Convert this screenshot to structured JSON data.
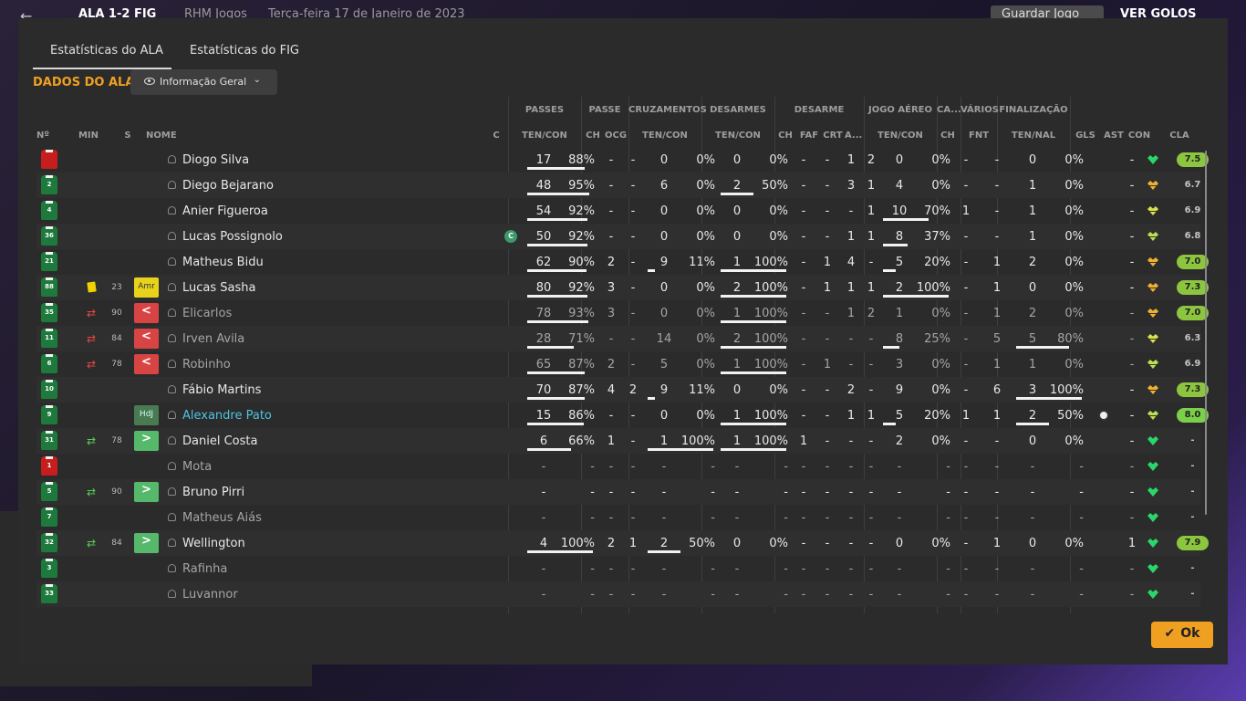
{
  "topbar": {
    "back": "←",
    "score": "ALA 1-2 FIG",
    "competition": "RHM Jogos",
    "date": "Terça-feira 17 de Janeiro de 2023",
    "save": "Guardar Jogo",
    "goals": "VER GOLOS"
  },
  "tabs": [
    {
      "label": "Estatísticas do ALA",
      "active": true
    },
    {
      "label": "Estatísticas do FIG",
      "active": false
    }
  ],
  "section_title": "DADOS DO ALA",
  "view_dropdown": {
    "label": "Informação Geral",
    "icon": "eye-icon"
  },
  "group_headers": [
    "PASSES",
    "PASSE",
    "CRUZAMENTOS",
    "DESARMES",
    "DESARME",
    "JOGO AÉREO",
    "CA...",
    "VÁRIOS",
    "FINALIZAÇÃO"
  ],
  "col_headers": {
    "no": "Nº",
    "min": "MIN",
    "s": "S",
    "name": "NOME",
    "c": "C",
    "passes": "TEN/CON",
    "passe_ch": "CH",
    "passe_ocg": "OCG",
    "cruz": "TEN/CON",
    "desarmes": "TEN/CON",
    "des_ch": "CH",
    "des_faf": "FAF",
    "des_crt": "CRT",
    "des_a": "A...",
    "aereo": "TEN/CON",
    "ca_ch": "CH",
    "varios_fnt": "FNT",
    "final": "TEN/NAL",
    "gls": "GLS",
    "ast": "AST",
    "con": "CON",
    "cla": "CLA"
  },
  "players": [
    {
      "no": "",
      "gk": true,
      "min": "",
      "s": "",
      "name": "Diogo Silva",
      "cap": false,
      "p": [
        "17",
        "88%"
      ],
      "pbar": 0.88,
      "pch": "-",
      "pocg": "-",
      "cr": [
        "0",
        "0%"
      ],
      "crbar": 0,
      "de": [
        "0",
        "0%"
      ],
      "debar": 0,
      "dch": "-",
      "faf": "-",
      "crt": "1",
      "da": "2",
      "ae": [
        "0",
        "0%"
      ],
      "aebar": 0,
      "cach": "-",
      "fnt": "-",
      "fi": [
        "0",
        "0%"
      ],
      "fibar": 0,
      "gls": "",
      "ast": "-",
      "con": "green",
      "cla": "7.5",
      "clastyle": "hi"
    },
    {
      "no": "2",
      "min": "",
      "s": "",
      "name": "Diego Bejarano",
      "p": [
        "48",
        "95%"
      ],
      "pbar": 0.95,
      "pch": "-",
      "pocg": "-",
      "cr": [
        "6",
        "0%"
      ],
      "crbar": 0,
      "de": [
        "2",
        "50%"
      ],
      "debar": 0.5,
      "dch": "-",
      "faf": "-",
      "crt": "3",
      "da": "1",
      "ae": [
        "4",
        "0%"
      ],
      "aebar": 0,
      "cach": "-",
      "fnt": "-",
      "fi": [
        "1",
        "0%"
      ],
      "fibar": 0,
      "gls": "",
      "ast": "-",
      "con": "orange",
      "cla": "6.7",
      "clastyle": "plain"
    },
    {
      "no": "4",
      "min": "",
      "s": "",
      "name": "Anier Figueroa",
      "p": [
        "54",
        "92%"
      ],
      "pbar": 0.92,
      "pch": "-",
      "pocg": "-",
      "cr": [
        "0",
        "0%"
      ],
      "crbar": 0,
      "de": [
        "0",
        "0%"
      ],
      "debar": 0,
      "dch": "-",
      "faf": "-",
      "crt": "-",
      "da": "1",
      "ae": [
        "10",
        "70%"
      ],
      "aebar": 0.7,
      "cach": "1",
      "fnt": "-",
      "fi": [
        "1",
        "0%"
      ],
      "fibar": 0,
      "gls": "",
      "ast": "-",
      "con": "yellow",
      "cla": "6.9",
      "clastyle": "plain"
    },
    {
      "no": "36",
      "min": "",
      "s": "",
      "name": "Lucas Possignolo",
      "cap": true,
      "p": [
        "50",
        "92%"
      ],
      "pbar": 0.92,
      "pch": "-",
      "pocg": "-",
      "cr": [
        "0",
        "0%"
      ],
      "crbar": 0,
      "de": [
        "0",
        "0%"
      ],
      "debar": 0,
      "dch": "-",
      "faf": "-",
      "crt": "1",
      "da": "1",
      "ae": [
        "8",
        "37%"
      ],
      "aebar": 0.37,
      "cach": "-",
      "fnt": "-",
      "fi": [
        "1",
        "0%"
      ],
      "fibar": 0,
      "gls": "",
      "ast": "-",
      "con": "ygreen",
      "cla": "6.8",
      "clastyle": "plain"
    },
    {
      "no": "21",
      "min": "",
      "s": "",
      "name": "Matheus Bidu",
      "p": [
        "62",
        "90%"
      ],
      "pbar": 0.9,
      "pch": "2",
      "pocg": "-",
      "cr": [
        "9",
        "11%"
      ],
      "crbar": 0.11,
      "de": [
        "1",
        "100%"
      ],
      "debar": 1,
      "dch": "-",
      "faf": "1",
      "crt": "4",
      "da": "-",
      "ae": [
        "5",
        "20%"
      ],
      "aebar": 0.2,
      "cach": "-",
      "fnt": "1",
      "fi": [
        "2",
        "0%"
      ],
      "fibar": 0,
      "gls": "",
      "ast": "-",
      "con": "orange",
      "cla": "7.0",
      "clastyle": "hi"
    },
    {
      "no": "88",
      "card": "yellow",
      "min": "23",
      "s": "Amr",
      "stag": "amr",
      "name": "Lucas Sasha",
      "p": [
        "80",
        "92%"
      ],
      "pbar": 0.92,
      "pch": "3",
      "pocg": "-",
      "cr": [
        "0",
        "0%"
      ],
      "crbar": 0,
      "de": [
        "2",
        "100%"
      ],
      "debar": 1,
      "dch": "-",
      "faf": "1",
      "crt": "1",
      "da": "1",
      "ae": [
        "2",
        "100%"
      ],
      "aebar": 1,
      "cach": "-",
      "fnt": "1",
      "fi": [
        "0",
        "0%"
      ],
      "fibar": 0,
      "gls": "",
      "ast": "-",
      "con": "orange",
      "cla": "7.3",
      "clastyle": "hi"
    },
    {
      "no": "35",
      "subarrow": "out",
      "min": "90",
      "s": "<",
      "stag": "out",
      "out": true,
      "name": "Elicarlos",
      "p": [
        "78",
        "93%"
      ],
      "pbar": 0.93,
      "pch": "3",
      "pocg": "-",
      "cr": [
        "0",
        "0%"
      ],
      "crbar": 0,
      "de": [
        "1",
        "100%"
      ],
      "debar": 1,
      "dch": "-",
      "faf": "-",
      "crt": "1",
      "da": "2",
      "ae": [
        "1",
        "0%"
      ],
      "aebar": 0,
      "cach": "-",
      "fnt": "1",
      "fi": [
        "2",
        "0%"
      ],
      "fibar": 0,
      "gls": "",
      "ast": "-",
      "con": "orange",
      "cla": "7.0",
      "clastyle": "hi"
    },
    {
      "no": "11",
      "subarrow": "out",
      "min": "84",
      "s": "<",
      "stag": "out",
      "out": true,
      "name": "Irven Avila",
      "p": [
        "28",
        "71%"
      ],
      "pbar": 0.71,
      "pch": "-",
      "pocg": "-",
      "cr": [
        "14",
        "0%"
      ],
      "crbar": 0,
      "de": [
        "2",
        "100%"
      ],
      "debar": 1,
      "dch": "-",
      "faf": "-",
      "crt": "-",
      "da": "-",
      "ae": [
        "8",
        "25%"
      ],
      "aebar": 0.25,
      "cach": "-",
      "fnt": "5",
      "fi": [
        "5",
        "80%"
      ],
      "fibar": 0.8,
      "gls": "",
      "ast": "-",
      "con": "yellow",
      "cla": "6.3",
      "clastyle": "plain"
    },
    {
      "no": "6",
      "subarrow": "out",
      "min": "78",
      "s": "<",
      "stag": "out",
      "out": true,
      "name": "Robinho",
      "p": [
        "65",
        "87%"
      ],
      "pbar": 0.87,
      "pch": "2",
      "pocg": "-",
      "cr": [
        "5",
        "0%"
      ],
      "crbar": 0,
      "de": [
        "1",
        "100%"
      ],
      "debar": 1,
      "dch": "-",
      "faf": "1",
      "crt": "-",
      "da": "-",
      "ae": [
        "3",
        "0%"
      ],
      "aebar": 0,
      "cach": "-",
      "fnt": "1",
      "fi": [
        "1",
        "0%"
      ],
      "fibar": 0,
      "gls": "",
      "ast": "-",
      "con": "ygreen",
      "cla": "6.9",
      "clastyle": "plain"
    },
    {
      "no": "10",
      "min": "",
      "s": "",
      "name": "Fábio Martins",
      "p": [
        "70",
        "87%"
      ],
      "pbar": 0.87,
      "pch": "4",
      "pocg": "2",
      "cr": [
        "9",
        "11%"
      ],
      "crbar": 0.11,
      "de": [
        "0",
        "0%"
      ],
      "debar": 0,
      "dch": "-",
      "faf": "-",
      "crt": "2",
      "da": "-",
      "ae": [
        "9",
        "0%"
      ],
      "aebar": 0,
      "cach": "-",
      "fnt": "6",
      "fi": [
        "3",
        "100%"
      ],
      "fibar": 1,
      "gls": "",
      "ast": "-",
      "con": "orange",
      "cla": "7.3",
      "clastyle": "hi"
    },
    {
      "no": "9",
      "min": "",
      "s": "HdJ",
      "stag": "hdj",
      "name": "Alexandre Pato",
      "hl": true,
      "p": [
        "15",
        "86%"
      ],
      "pbar": 0.86,
      "pch": "-",
      "pocg": "-",
      "cr": [
        "0",
        "0%"
      ],
      "crbar": 0,
      "de": [
        "1",
        "100%"
      ],
      "debar": 1,
      "dch": "-",
      "faf": "-",
      "crt": "1",
      "da": "1",
      "ae": [
        "5",
        "20%"
      ],
      "aebar": 0.2,
      "cach": "1",
      "fnt": "1",
      "fi": [
        "2",
        "50%"
      ],
      "fibar": 0.5,
      "gls": "ball",
      "ast": "-",
      "con": "ygreen",
      "cla": "8.0",
      "clastyle": "top"
    },
    {
      "no": "31",
      "subarrow": "in",
      "min": "78",
      "s": ">",
      "stag": "in",
      "name": "Daniel Costa",
      "p": [
        "6",
        "66%"
      ],
      "pbar": 0.66,
      "pch": "1",
      "pocg": "-",
      "cr": [
        "1",
        "100%"
      ],
      "crbar": 1,
      "de": [
        "1",
        "100%"
      ],
      "debar": 1,
      "dch": "1",
      "faf": "-",
      "crt": "-",
      "da": "-",
      "ae": [
        "2",
        "0%"
      ],
      "aebar": 0,
      "cach": "-",
      "fnt": "-",
      "fi": [
        "0",
        "0%"
      ],
      "fibar": 0,
      "gls": "",
      "ast": "-",
      "con": "green",
      "cla": "-",
      "clastyle": "plain"
    },
    {
      "no": "1",
      "gk": true,
      "min": "",
      "s": "",
      "name": "Mota",
      "out": true,
      "p": [
        "-",
        "-"
      ],
      "pbar": 0,
      "pch": "-",
      "pocg": "-",
      "cr": [
        "-",
        "-"
      ],
      "crbar": 0,
      "de": [
        "-",
        "-"
      ],
      "debar": 0,
      "dch": "-",
      "faf": "-",
      "crt": "-",
      "da": "-",
      "ae": [
        "-",
        "-"
      ],
      "aebar": 0,
      "cach": "-",
      "fnt": "-",
      "fi": [
        "-",
        "-"
      ],
      "fibar": 0,
      "gls": "",
      "ast": "-",
      "con": "green",
      "cla": "-",
      "clastyle": "plain"
    },
    {
      "no": "5",
      "subarrow": "in",
      "min": "90",
      "s": ">",
      "stag": "in",
      "name": "Bruno Pirri",
      "p": [
        "-",
        "-"
      ],
      "pbar": 0,
      "pch": "-",
      "pocg": "-",
      "cr": [
        "-",
        "-"
      ],
      "crbar": 0,
      "de": [
        "-",
        "-"
      ],
      "debar": 0,
      "dch": "-",
      "faf": "-",
      "crt": "-",
      "da": "-",
      "ae": [
        "-",
        "-"
      ],
      "aebar": 0,
      "cach": "-",
      "fnt": "-",
      "fi": [
        "-",
        "-"
      ],
      "fibar": 0,
      "gls": "",
      "ast": "-",
      "con": "green",
      "cla": "-",
      "clastyle": "plain"
    },
    {
      "no": "7",
      "min": "",
      "s": "",
      "name": "Matheus Aiás",
      "out": true,
      "p": [
        "-",
        "-"
      ],
      "pbar": 0,
      "pch": "-",
      "pocg": "-",
      "cr": [
        "-",
        "-"
      ],
      "crbar": 0,
      "de": [
        "-",
        "-"
      ],
      "debar": 0,
      "dch": "-",
      "faf": "-",
      "crt": "-",
      "da": "-",
      "ae": [
        "-",
        "-"
      ],
      "aebar": 0,
      "cach": "-",
      "fnt": "-",
      "fi": [
        "-",
        "-"
      ],
      "fibar": 0,
      "gls": "",
      "ast": "-",
      "con": "green",
      "cla": "-",
      "clastyle": "plain"
    },
    {
      "no": "32",
      "subarrow": "in",
      "min": "84",
      "s": ">",
      "stag": "in",
      "name": "Wellington",
      "p": [
        "4",
        "100%"
      ],
      "pbar": 1,
      "pch": "2",
      "pocg": "1",
      "cr": [
        "2",
        "50%"
      ],
      "crbar": 0.5,
      "de": [
        "0",
        "0%"
      ],
      "debar": 0,
      "dch": "-",
      "faf": "-",
      "crt": "-",
      "da": "-",
      "ae": [
        "0",
        "0%"
      ],
      "aebar": 0,
      "cach": "-",
      "fnt": "1",
      "fi": [
        "0",
        "0%"
      ],
      "fibar": 0,
      "gls": "",
      "ast": "1",
      "con": "green",
      "cla": "7.9",
      "clastyle": "hi"
    },
    {
      "no": "3",
      "min": "",
      "s": "",
      "name": "Rafinha",
      "out": true,
      "p": [
        "-",
        "-"
      ],
      "pbar": 0,
      "pch": "-",
      "pocg": "-",
      "cr": [
        "-",
        "-"
      ],
      "crbar": 0,
      "de": [
        "-",
        "-"
      ],
      "debar": 0,
      "dch": "-",
      "faf": "-",
      "crt": "-",
      "da": "-",
      "ae": [
        "-",
        "-"
      ],
      "aebar": 0,
      "cach": "-",
      "fnt": "-",
      "fi": [
        "-",
        "-"
      ],
      "fibar": 0,
      "gls": "",
      "ast": "-",
      "con": "green",
      "cla": "-",
      "clastyle": "plain"
    },
    {
      "no": "33",
      "min": "",
      "s": "",
      "name": "Luvannor",
      "out": true,
      "p": [
        "-",
        "-"
      ],
      "pbar": 0,
      "pch": "-",
      "pocg": "-",
      "cr": [
        "-",
        "-"
      ],
      "crbar": 0,
      "de": [
        "-",
        "-"
      ],
      "debar": 0,
      "dch": "-",
      "faf": "-",
      "crt": "-",
      "da": "-",
      "ae": [
        "-",
        "-"
      ],
      "aebar": 0,
      "cach": "-",
      "fnt": "-",
      "fi": [
        "-",
        "-"
      ],
      "fibar": 0,
      "gls": "",
      "ast": "-",
      "con": "green",
      "cla": "-",
      "clastyle": "plain"
    }
  ],
  "ok_label": "Ok",
  "colors": {
    "accent": "#f0a020",
    "panel": "#2b2b2b",
    "highlight_name": "#4fc3e0"
  }
}
